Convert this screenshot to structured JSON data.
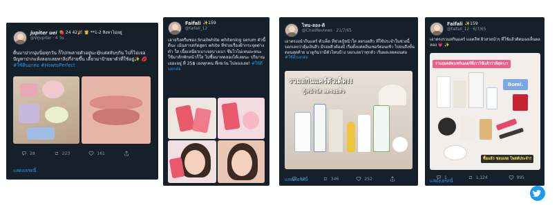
{
  "colors": {
    "card_bg": "#15202b",
    "link": "#1d9bf0",
    "muted": "#8b98a5",
    "text": "#e7e9ea"
  },
  "tweets": [
    {
      "display_name": "jupiter uei",
      "badges": "🍓 24 42🎉 👸 **1-2 สิงหาไม่อยู่",
      "handle": "@WJupiter · 4 วัน",
      "text": "ตื่นมาปากนุ่มนิ่มทุกวัน ก็ไปกพลายตัวอยู่นะ😆แต่สลับๆกัน ไปก็ไม่เจอปัญหาปากแห้งลอกเลยหาลิปกี่ง่ายขึ้น เตี้ยวมาป้ายยาตัวที่ใช้อยู่✨",
      "hashtags": "💋 #ใช้ดีบอกต่อ #HowtoPerfect",
      "replies": "28",
      "retweets": "223",
      "likes": "161",
      "show_more": "แสดงเธรดนี้"
    },
    {
      "display_name": "Faifali",
      "badges": "✨159",
      "handle": "@faifali_12",
      "text": "เอาจริงครีมซอง Snailwhite whitening serum ตัวนี้ดีนะ เน้นสารสกัดสูตร white ที่ช่วยเรื่องฝ้ากระจุดด่างดำ ใส เนื้อเหนียวเบาเจลบางเบา ซึมไวไม่เหนอะหนะ ใช้มาสักพักหน้าก็ใส ไปซื้อมาทดลองได้เลยนะ ปริมาณเยอะอยู่ ที่ 25฿ เองทุกคน ที่เซเว่น ไปลองเลย!",
      "hashtags": "#ใช้ดีบอกต่อ"
    },
    {
      "display_name": "ไหน-ลอง-ดิ",
      "handle": "@ChaliReviews · 21/7/65",
      "text": "เอาตรงงนำกีนแคร์ ตัวเด็ด ที่ช่วยกู้หน้าใส ลดรอยสิว ที่ใช้ประจำในช่วงนี้ บอกเลยว่าคุ้มเงินสิว มีรอยสิวต้องมี เริ่มตั้งแต่คลีนเซอร์ตอนเช้า ไปจนถึงขั้นตอนสุดท้าย มาดูกันว่ามีตัวไหนบ้าง บอกเลยว่าทุกตัว เริ่มผลเลยตอนต่อ",
      "hashtags": "#ใช้ดีบอกต่อ",
      "media_title": "รวมสกินแคร์ตัวเด็ด!!",
      "media_subtitle": "กู้หน้าใส ลดรอยสิว",
      "replies": "12",
      "retweets": "346",
      "likes": "252",
      "show_more": "แสดงเธรดนี้"
    },
    {
      "display_name": "Faifali",
      "badges": "✨159",
      "handle": "@faifali_12 · 6/7/65",
      "text": "เอาตรงรวมสกินแคร์ แอคลีฟ ผิวสวยนำๆ ที่ใช้แล้วติดมองเห็นผลลอง 💗 ✨",
      "media_banner": "รวม(ผลลัพ)/สกินแคร์ที่เราใช้แล้วว่าดีสุดๆ!!",
      "media_brand": "Bomi.",
      "media_footer": "ซื้อแล้ว ชอบเลย โพสต์ประจำ!",
      "replies": "1",
      "retweets": "1,124",
      "likes": "995",
      "show_more": "แสดงเธรดนี้"
    }
  ]
}
